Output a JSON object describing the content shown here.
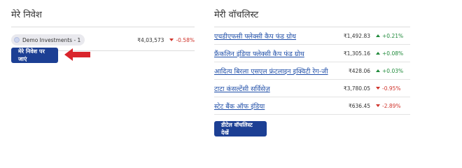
{
  "investments": {
    "title": "मेरे निवेश",
    "items": [
      {
        "name": "Demo Investments - 1",
        "value": "₹4,03,573",
        "change": "-0.58%",
        "direction": "down"
      }
    ],
    "button_label": "मेरे निवेश पर जाएं"
  },
  "watchlist": {
    "title": "मेरी वॉचलिस्ट",
    "items": [
      {
        "name": "एचडीएफसी फ्लेक्सी कैप फंड ग्रोथ",
        "price": "₹1,492.83",
        "change": "+0.21%",
        "direction": "up"
      },
      {
        "name": "फ्रैंकलिन इंडिया फ्लेक्सी कैप फंड ग्रोथ",
        "price": "₹1,305.16",
        "change": "+0.08%",
        "direction": "up"
      },
      {
        "name": "आदित्य बिरला एसएल फ्रंटलाइन इक्विटी रेग-जी",
        "price": "₹428.06",
        "change": "+0.03%",
        "direction": "up"
      },
      {
        "name": "टाटा कंसल्टेंसी सर्विसेज़",
        "price": "₹3,780.05",
        "change": "-0.95%",
        "direction": "down"
      },
      {
        "name": "स्टेट बैंक ऑफ इंडिया",
        "price": "₹636.45",
        "change": "-2.89%",
        "direction": "down"
      }
    ],
    "button_label": "डीटेल वॉचलिस्ट देखें"
  },
  "colors": {
    "button": "#1c3f94",
    "arrow": "#d9242b",
    "positive": "#1f8a3a",
    "negative": "#d0342c",
    "link": "#1f4ea8"
  },
  "icons": {
    "arrow": "left-arrow-icon",
    "pill_dot": "account-dot-icon",
    "up": "triangle-up-icon",
    "down": "triangle-down-icon"
  }
}
